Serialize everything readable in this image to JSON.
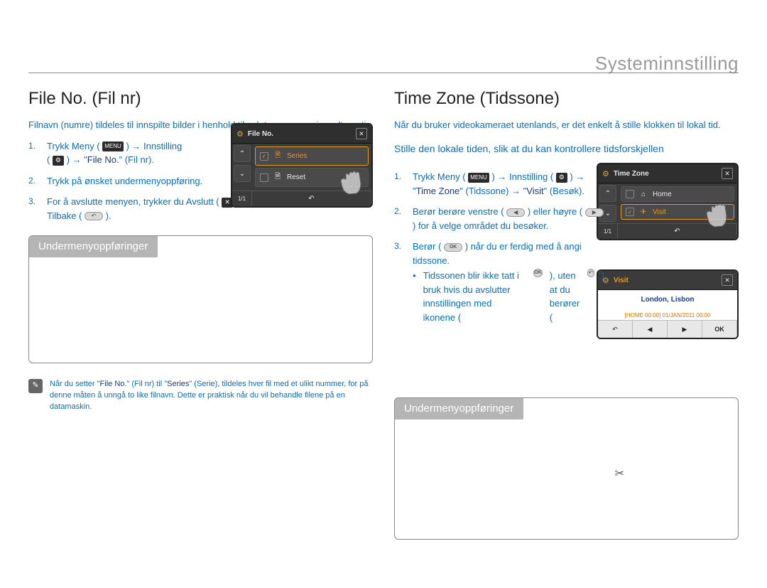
{
  "chapter": "Systeminnstilling",
  "left": {
    "heading": "File No. (Fil nr)",
    "intro": "Filnavn (numre) tildeles til innspilte bilder i henhold til valgte nummereringsalternativ.",
    "steps": {
      "s1a": "Trykk Meny (",
      "s1b": ") → Innstilling",
      "s1c": "(",
      "s1d": ") → \"",
      "s1e": "File No.",
      "s1f": "\" (Fil nr).",
      "s2": "Trykk på ønsket undermenyoppføring.",
      "s3a": "For å avslutte menyen, trykker du Avslutt (",
      "s3b": ") eller Tilbake (",
      "s3c": ")."
    },
    "subheading": "Undermenyoppføringer",
    "note_a": "Når du setter \"",
    "note_b": "File No.",
    "note_c": "\" (Fil nr) til \"",
    "note_d": "Series",
    "note_e": "\" (Serie), tildeles hver fil med et ulikt nummer, for på denne måten å unngå to like filnavn. Dette er praktisk når du vil behandle filene på en datamaskin.",
    "lcd": {
      "title": "File No.",
      "row1": "Series",
      "row2": "Reset",
      "page": "1/1"
    }
  },
  "right": {
    "heading": "Time Zone (Tidssone)",
    "intro": "Når du bruker videokameraet utenlands, er det enkelt å stille klokken til lokal tid.",
    "callout": "Stille den lokale tiden, slik at du kan kontrollere tidsforskjellen",
    "steps": {
      "s1a": "Trykk Meny (",
      "s1b": ") → Innstilling (",
      "s1c": ") → \"",
      "s1d": "Time Zone",
      "s1e": "\" (Tidssone) → \"",
      "s1f": "Visit",
      "s1g": "\" (Besøk).",
      "s2a": "Berør berøre venstre (",
      "s2b": ") eller høyre (",
      "s2c": ") for å velge området du besøker.",
      "s3a": "Berør (",
      "s3b": ") når du er ferdig med å angi tidssone.",
      "sub1a": "Tidssonen blir ikke tatt i bruk hvis du avslutter innstillingen med ikonene (",
      "sub1b": "), uten at du berører (",
      "sub1c": ")."
    },
    "subheading": "Undermenyoppføringer",
    "lcd1": {
      "title": "Time Zone",
      "row1": "Home",
      "row2": "Visit",
      "page": "1/1"
    },
    "lcd2": {
      "title": "Visit",
      "city": "London, Lisbon",
      "home": "[HOME 00:00] 01/JAN/2011 00:00",
      "ok": "OK"
    }
  },
  "icons": {
    "menu": "MENU",
    "ok": "OK"
  }
}
